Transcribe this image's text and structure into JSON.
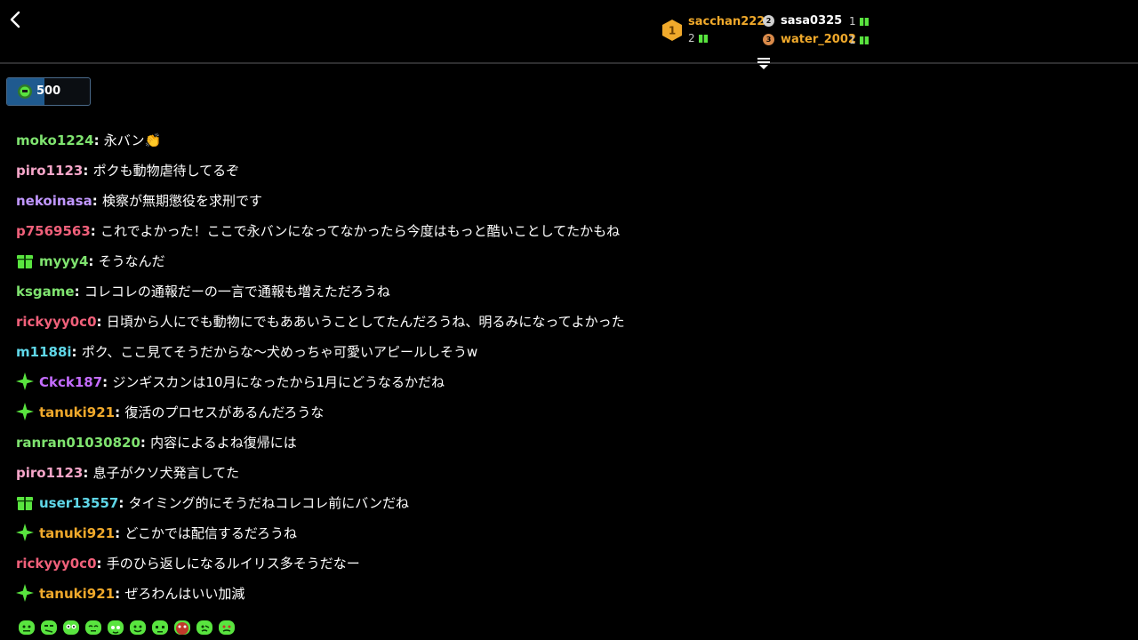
{
  "colors": {
    "background": "#000000",
    "gold": "#f0a92b",
    "green": "#59e43f",
    "white": "#ffffff"
  },
  "header": {
    "back_icon": "chevron-left-icon",
    "collapse_icon": "collapse-list-icon",
    "leaderboard": [
      {
        "rank": "1",
        "name": "sacchan222",
        "count": "2",
        "name_color": "#f0a92b"
      },
      {
        "rank": "2",
        "name": "sasa0325",
        "count": "1",
        "name_color": "#ffffff"
      },
      {
        "rank": "3",
        "name": "water_2002",
        "count": "1",
        "name_color": "#f0a92b"
      }
    ]
  },
  "points": {
    "value": "500",
    "fill_fraction": 0.45
  },
  "chat": {
    "messages": [
      {
        "user": "moko1224",
        "text": "永バン👏",
        "color": "#7fe36f",
        "badge": ""
      },
      {
        "user": "piro1123",
        "text": "ポクも動物虐待してるぞ",
        "color": "#f6a6c9",
        "badge": ""
      },
      {
        "user": "nekoinasa",
        "text": "検察が無期懲役を求刑です",
        "color": "#c197ff",
        "badge": ""
      },
      {
        "user": "p7569563",
        "text": "これでよかった！ここで永バンになってなかったら今度はもっと酷いことしてたかもね",
        "color": "#f0607a",
        "badge": ""
      },
      {
        "user": "myyy4",
        "text": "そうなんだ",
        "color": "#7fe36f",
        "badge": "gift"
      },
      {
        "user": "ksgame",
        "text": "コレコレの通報だーの一言で通報も増えただろうね",
        "color": "#7fe36f",
        "badge": ""
      },
      {
        "user": "rickyyy0c0",
        "text": "日頃から人にでも動物にでもああいうことしてたんだろうね、明るみになってよかった",
        "color": "#f0607a",
        "badge": ""
      },
      {
        "user": "m1188i",
        "text": "ポク、ここ見てそうだからな〜犬めっちゃ可愛いアピールしそうw",
        "color": "#5fd7e8",
        "badge": ""
      },
      {
        "user": "Ckck187",
        "text": "ジンギスカンは10月になったから1月にどうなるかだね",
        "color": "#c46cff",
        "badge": "sparkle"
      },
      {
        "user": "tanuki921",
        "text": "復活のプロセスがあるんだろうな",
        "color": "#f0a92b",
        "badge": "sparkle"
      },
      {
        "user": "ranran01030820",
        "text": "内容によるよね復帰には",
        "color": "#7fe36f",
        "badge": ""
      },
      {
        "user": "piro1123",
        "text": "息子がクソ犬発言してた",
        "color": "#f6a6c9",
        "badge": ""
      },
      {
        "user": "user13557",
        "text": "タイミング的にそうだねコレコレ前にバンだね",
        "color": "#5fd7e8",
        "badge": "gift"
      },
      {
        "user": "tanuki921",
        "text": "どこかでは配信するだろうね",
        "color": "#f0a92b",
        "badge": "sparkle"
      },
      {
        "user": "rickyyy0c0",
        "text": "手のひら返しになるルイリス多そうだなー",
        "color": "#f0607a",
        "badge": ""
      },
      {
        "user": "tanuki921",
        "text": "ぜろわんはいい加減",
        "color": "#f0a92b",
        "badge": "sparkle"
      }
    ]
  },
  "emotes": [
    "emote-1-icon",
    "emote-2-icon",
    "emote-3-icon",
    "emote-4-icon",
    "emote-5-icon",
    "emote-6-icon",
    "emote-7-icon",
    "emote-8-icon",
    "emote-9-icon",
    "emote-10-icon"
  ]
}
